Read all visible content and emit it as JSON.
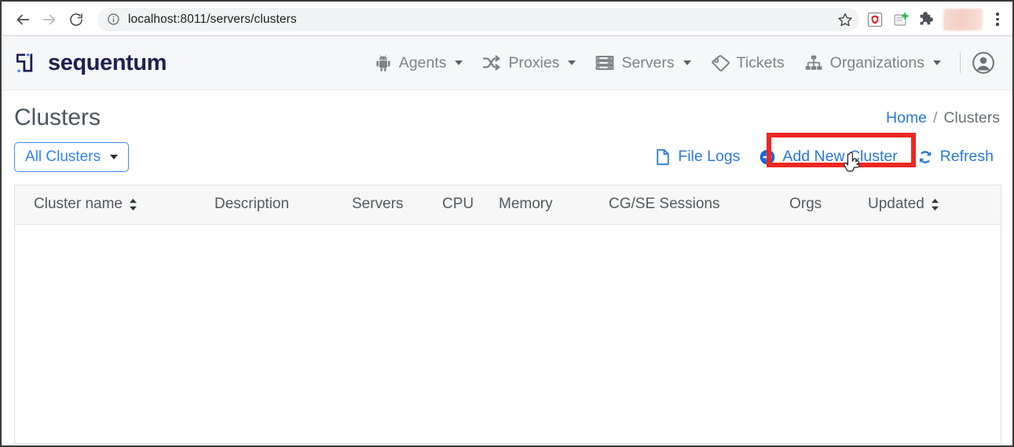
{
  "browser": {
    "back_icon": "arrow-left-icon",
    "forward_icon": "arrow-right-icon",
    "reload_icon": "reload-icon",
    "site_info_icon": "info-circle-icon",
    "url_host": "localhost:8011",
    "url_path": "/servers/clusters",
    "url_full": "localhost:8011/servers/clusters",
    "bookmark_icon": "star-icon",
    "extensions": [
      {
        "name": "shield-extension-icon",
        "color": "#d8232a"
      },
      {
        "name": "add-extension-icon",
        "color": "#2db34a"
      },
      {
        "name": "puzzle-extensions-icon",
        "color": "#4b4f56"
      }
    ],
    "profile_avatar": "profile-avatar-blurred",
    "menu_icon": "three-dot-menu-icon"
  },
  "navbar": {
    "brand": "sequentum",
    "brand_color": "#1d2050",
    "items": [
      {
        "label": "Agents",
        "icon": "android-robot-icon",
        "has_caret": true
      },
      {
        "label": "Proxies",
        "icon": "shuffle-arrows-icon",
        "has_caret": true
      },
      {
        "label": "Servers",
        "icon": "server-stack-icon",
        "has_caret": true
      },
      {
        "label": "Tickets",
        "icon": "ticket-icon",
        "has_caret": false
      },
      {
        "label": "Organizations",
        "icon": "sitemap-icon",
        "has_caret": true
      }
    ],
    "user_icon": "user-circle-icon"
  },
  "page": {
    "title": "Clusters",
    "breadcrumb": {
      "home": "Home",
      "separator": "/",
      "current": "Clusters"
    }
  },
  "toolbar": {
    "filter_label": "All Clusters",
    "filter_caret_icon": "chevron-down-icon",
    "actions": [
      {
        "label": "File Logs",
        "icon": "file-document-icon",
        "highlighted": false
      },
      {
        "label": "Add New Cluster",
        "icon": "plus-circle-icon",
        "highlighted": true
      },
      {
        "label": "Refresh",
        "icon": "refresh-sync-icon",
        "highlighted": false
      }
    ],
    "link_color": "#2979d8",
    "annotation_color": "#ee2722",
    "cursor_icon": "pointer-hand-cursor"
  },
  "table": {
    "columns": [
      {
        "label": "Cluster name",
        "sortable": true
      },
      {
        "label": "Description",
        "sortable": false
      },
      {
        "label": "Servers",
        "sortable": false
      },
      {
        "label": "CPU",
        "sortable": false
      },
      {
        "label": "Memory",
        "sortable": false
      },
      {
        "label": "CG/SE Sessions",
        "sortable": false
      },
      {
        "label": "Orgs",
        "sortable": false
      },
      {
        "label": "Updated",
        "sortable": true
      }
    ],
    "rows": []
  }
}
